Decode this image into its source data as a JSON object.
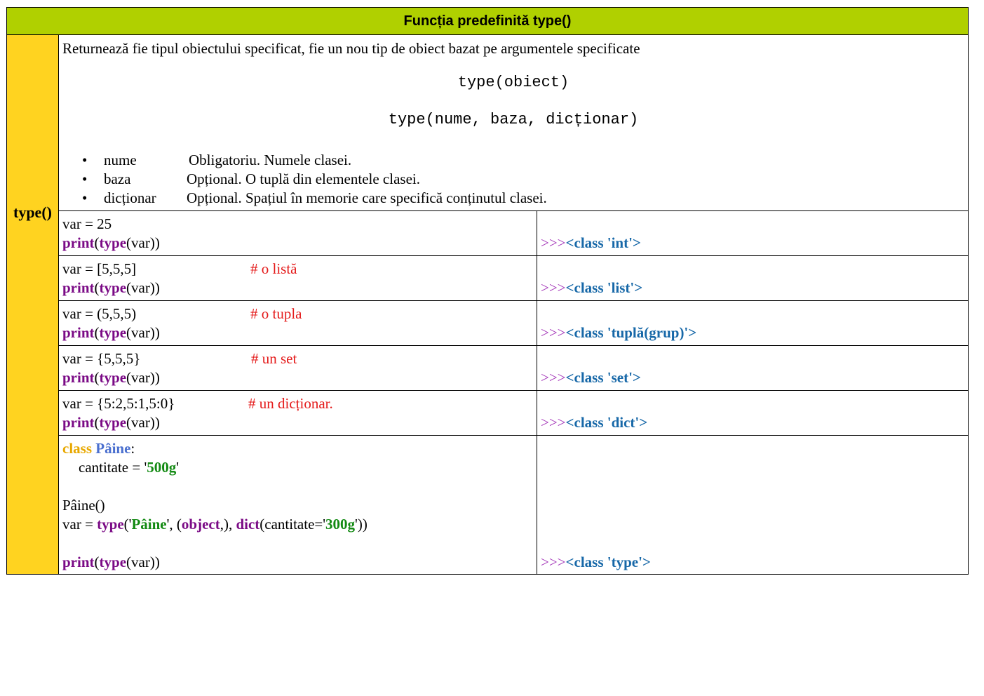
{
  "title": "Funcția predefinită type()",
  "side_label": "type()",
  "description": {
    "intro": "Returnează fie tipul obiectului specificat, fie un nou tip de obiect bazat pe argumentele specificate",
    "syntax1": "type(obiect)",
    "syntax2": "type(nume, baza, dicționar)",
    "params": [
      {
        "name": "nume",
        "desc": "Obligatoriu. Numele clasei."
      },
      {
        "name": "baza",
        "desc": "Opțional. O tuplă din elementele clasei."
      },
      {
        "name": "dicționar",
        "desc": "Opțional. Spațiul în memorie care specifică conținutul clasei."
      }
    ]
  },
  "tokens": {
    "print": "print",
    "type": "type",
    "arg": "(var))",
    "open": "(",
    "prompt": ">>>"
  },
  "examples": [
    {
      "line1": "var = 25",
      "comment": "",
      "result": "<class 'int'>"
    },
    {
      "line1": "var = [5,5,5]",
      "comment": "# o listă",
      "result": "<class 'list'>"
    },
    {
      "line1": "var = (5,5,5)",
      "comment": "# o tupla",
      "result": "<class 'tuplă(grup)'>"
    },
    {
      "line1": "var = {5,5,5}",
      "comment": "# un set",
      "result": "<class 'set'>"
    },
    {
      "line1": "var = {5:2,5:1,5:0}",
      "comment": "# un dicționar.",
      "result": "<class 'dict'>"
    }
  ],
  "class_example": {
    "kw_class": "class",
    "class_name": "Pâine",
    "colon": ":",
    "attr": "cantitate = '",
    "attr_val": "500g",
    "quote": "'",
    "call": "Pâine()",
    "var_eq": "var = ",
    "type_kw": "type",
    "p1": "('",
    "name_str": "Pâine",
    "p2": "', (",
    "object_kw": "object",
    "p3": ",), ",
    "dict_kw": "dict",
    "p4": "(cantitate='",
    "val_str": "300g",
    "p5": "'))",
    "result": "<class 'type'>"
  }
}
